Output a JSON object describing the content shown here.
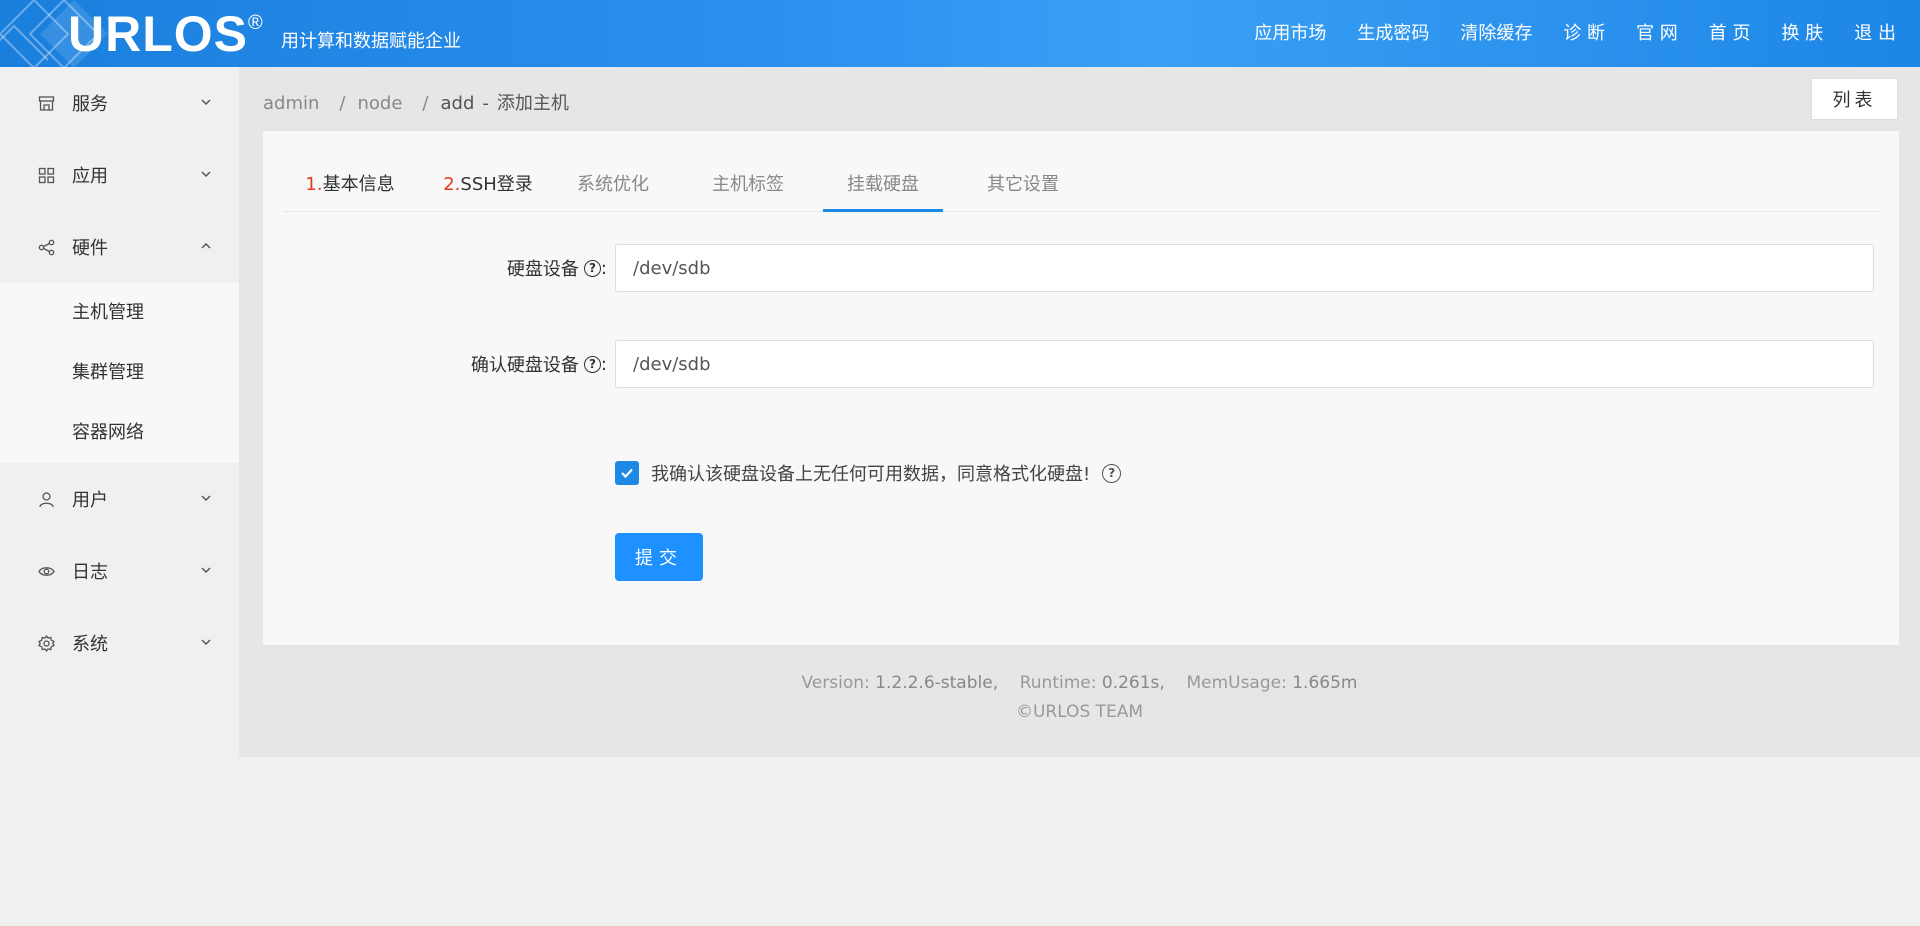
{
  "header": {
    "logo": "URLOS",
    "logo_reg": "®",
    "slogan": "用计算和数据赋能企业",
    "nav": [
      "应用市场",
      "生成密码",
      "清除缓存",
      "诊 断",
      "官 网",
      "首 页",
      "换 肤",
      "退 出"
    ]
  },
  "sidebar": {
    "items": [
      {
        "label": "服务",
        "icon": "store-icon",
        "expanded": false
      },
      {
        "label": "应用",
        "icon": "grid-icon",
        "expanded": false
      },
      {
        "label": "硬件",
        "icon": "share-icon",
        "expanded": true
      },
      {
        "label": "用户",
        "icon": "user-icon",
        "expanded": false
      },
      {
        "label": "日志",
        "icon": "eye-icon",
        "expanded": false
      },
      {
        "label": "系统",
        "icon": "gear-icon",
        "expanded": false
      }
    ],
    "hardware_sub": [
      "主机管理",
      "集群管理",
      "容器网络"
    ]
  },
  "breadcrumb": {
    "parts": [
      "admin",
      "node",
      "add"
    ],
    "dash": "-",
    "current": "添加主机"
  },
  "list_button": "列表",
  "tabs": [
    {
      "num": "1.",
      "label": "基本信息"
    },
    {
      "num": "2.",
      "label": "SSH登录"
    },
    {
      "num": "",
      "label": "系统优化"
    },
    {
      "num": "",
      "label": "主机标签"
    },
    {
      "num": "",
      "label": "挂载硬盘"
    },
    {
      "num": "",
      "label": "其它设置"
    }
  ],
  "form": {
    "disk_label": "硬盘设备",
    "disk_value": "/dev/sdb",
    "confirm_label": "确认硬盘设备",
    "confirm_value": "/dev/sdb",
    "colon": ":",
    "q": "?",
    "check_label": "我确认该硬盘设备上无任何可用数据，同意格式化硬盘!",
    "checked": true,
    "submit": "提交"
  },
  "footer": {
    "version_label": "Version:",
    "version": "1.2.2.6-stable,",
    "runtime_label": "Runtime:",
    "runtime": "0.261s,",
    "mem_label": "MemUsage:",
    "mem": "1.665m",
    "team": "©URLOS TEAM"
  },
  "colors": {
    "primary": "#1e88e5",
    "header": "#2a8ff0",
    "tab_number": "#e23b1c"
  }
}
